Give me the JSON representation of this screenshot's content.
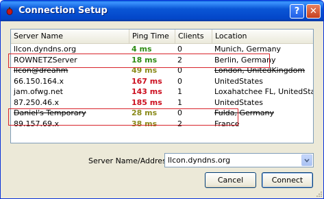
{
  "window": {
    "title": "Connection Setup",
    "help_label": "?",
    "close_label": "✕"
  },
  "list": {
    "columns": [
      "Server Name",
      "Ping Time",
      "Clients",
      "Location"
    ],
    "rows": [
      {
        "name": "llcon.dyndns.org",
        "ping": "4 ms",
        "clients": "0",
        "location": "Munich, Germany",
        "ping_color": "#2e8b14",
        "strike": false
      },
      {
        "name": "ROWNETZServer",
        "ping": "18 ms",
        "clients": "2",
        "location": "Berlin, Germany",
        "ping_color": "#2e8b14",
        "strike": false
      },
      {
        "name": "llcon@dreahm",
        "ping": "49 ms",
        "clients": "0",
        "location": "London, UnitedKingdom",
        "ping_color": "#8a8a1a",
        "strike": true
      },
      {
        "name": "66.150.164.x",
        "ping": "167 ms",
        "clients": "0",
        "location": "UnitedStates",
        "ping_color": "#cc1020",
        "strike": false
      },
      {
        "name": "jam.ofwg.net",
        "ping": "143 ms",
        "clients": "1",
        "location": "Loxahatchee FL, UnitedStat...",
        "ping_color": "#cc1020",
        "strike": false
      },
      {
        "name": "87.250.46.x",
        "ping": "185 ms",
        "clients": "1",
        "location": "UnitedStates",
        "ping_color": "#cc1020",
        "strike": false
      },
      {
        "name": "Daniel's Temporary",
        "ping": "28 ms",
        "clients": "0",
        "location": "Fulda, Germany",
        "ping_color": "#8a8a1a",
        "strike": true
      },
      {
        "name": "89.157.69.x",
        "ping": "38 ms",
        "clients": "2",
        "location": "France",
        "ping_color": "#8a8a1a",
        "strike": false
      }
    ]
  },
  "address": {
    "label": "Server Name/Address",
    "value": "llcon.dyndns.org"
  },
  "buttons": {
    "cancel": "Cancel",
    "connect": "Connect"
  },
  "icons": {
    "app": "app-icon",
    "dropdown": "chevron-down-icon"
  },
  "colors": {
    "titlebar": "#0a56d6",
    "highlight_box": "#d8232a"
  }
}
